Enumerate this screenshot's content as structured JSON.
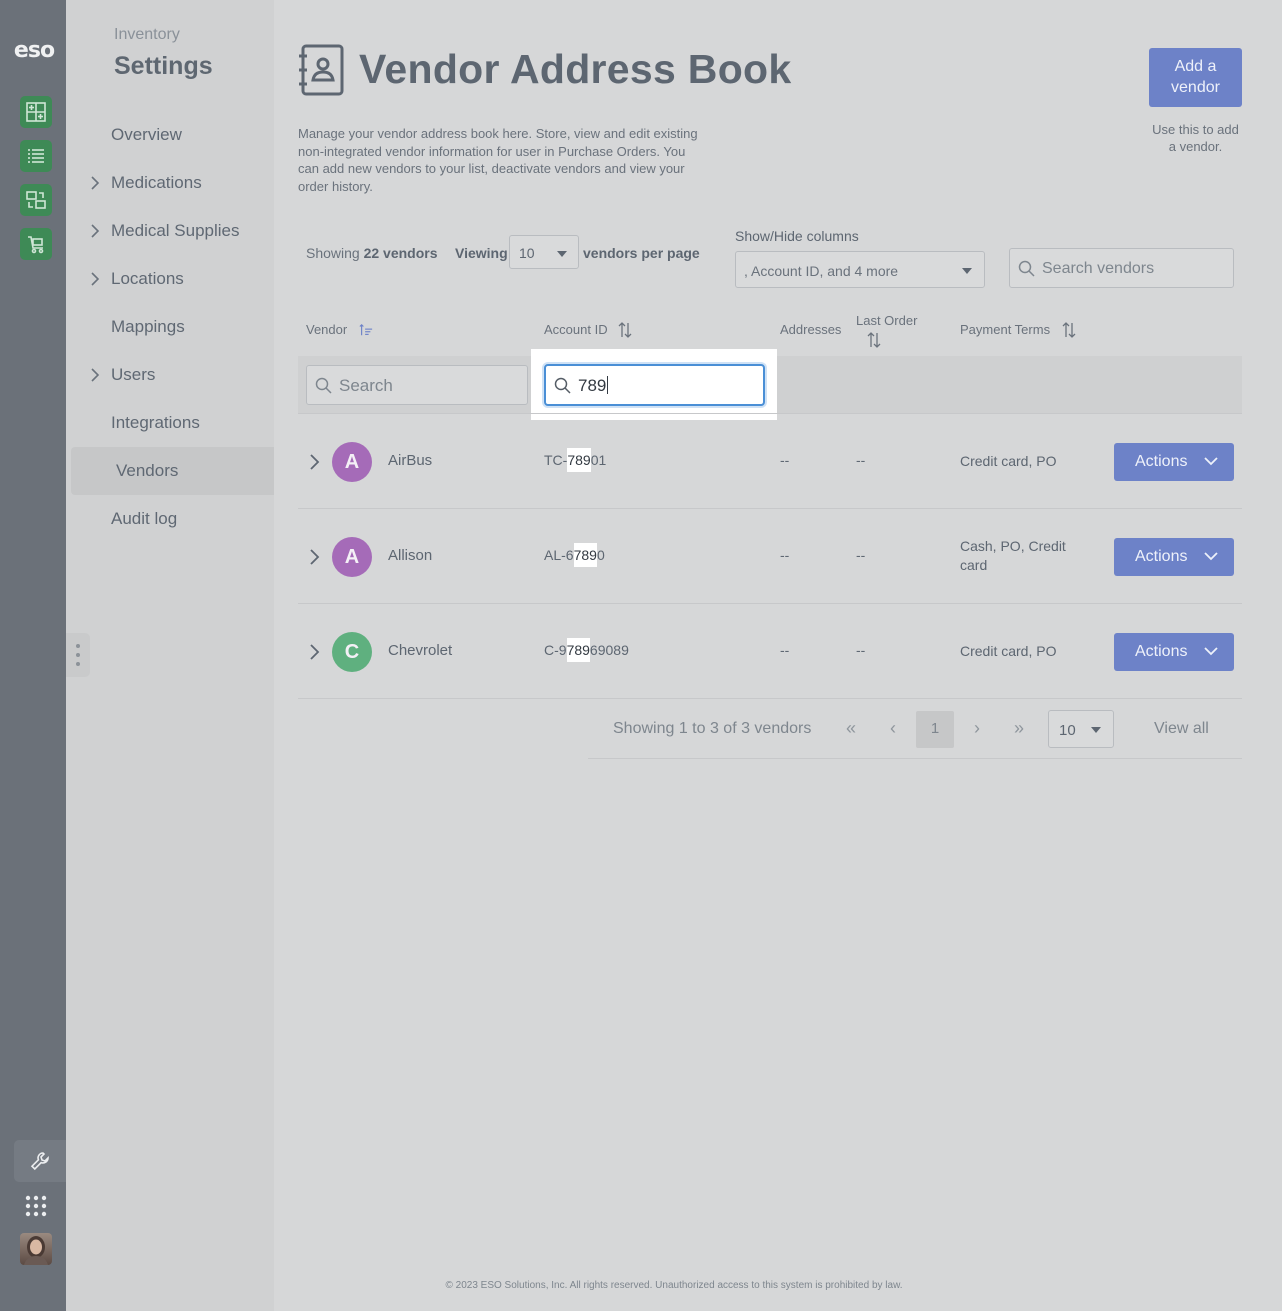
{
  "rail": {
    "logo": "eso",
    "apps": [
      {
        "icon": "inventory-grid-icon"
      },
      {
        "icon": "list-icon"
      },
      {
        "icon": "transfer-icon"
      },
      {
        "icon": "cart-icon"
      }
    ],
    "bottom": [
      "wrench-icon",
      "app-grid-icon",
      "user-avatar"
    ]
  },
  "nav": {
    "kicker": "Inventory",
    "title": "Settings",
    "items": [
      {
        "label": "Overview",
        "expandable": false
      },
      {
        "label": "Medications",
        "expandable": true
      },
      {
        "label": "Medical Supplies",
        "expandable": true
      },
      {
        "label": "Locations",
        "expandable": true
      },
      {
        "label": "Mappings",
        "expandable": false
      },
      {
        "label": "Users",
        "expandable": true
      },
      {
        "label": "Integrations",
        "expandable": false
      },
      {
        "label": "Vendors",
        "expandable": false,
        "active": true
      },
      {
        "label": "Audit log",
        "expandable": false
      }
    ]
  },
  "header": {
    "title": "Vendor Address Book",
    "description": "Manage your vendor address book here. Store, view and edit existing non-integrated vendor information for user in Purchase Orders. You can add new vendors to your list, deactivate vendors and view your order history.",
    "add_button": "Add a\nvendor",
    "add_hint": "Use this to add\na vendor."
  },
  "toolbar": {
    "showing_prefix": "Showing",
    "showing_count": "22 vendors",
    "viewing_label": "Viewing",
    "per_page": "10",
    "per_page_suffix": "vendors per page",
    "columns_label": "Show/Hide columns",
    "columns_value": ", Account ID, and 4 more",
    "search_placeholder": "Search vendors"
  },
  "table": {
    "headers": {
      "vendor": "Vendor",
      "account_id": "Account ID",
      "addresses": "Addresses",
      "last_order": "Last Order",
      "payment_terms": "Payment Terms"
    },
    "filters": {
      "vendor_placeholder": "Search",
      "account_value": "789"
    },
    "rows": [
      {
        "initial": "A",
        "avatar_color": "#a56bb8",
        "name": "AirBus",
        "acc_pre": "TC-",
        "acc_hit": "789",
        "acc_post": "01",
        "addresses": "--",
        "last_order": "--",
        "payment": "Credit card, PO",
        "action": "Actions"
      },
      {
        "initial": "A",
        "avatar_color": "#a56bb8",
        "name": "Allison",
        "acc_pre": "AL-6",
        "acc_hit": "789",
        "acc_post": "0",
        "addresses": "--",
        "last_order": "--",
        "payment": "Cash, PO, Credit card",
        "action": "Actions"
      },
      {
        "initial": "C",
        "avatar_color": "#5fb07f",
        "name": "Chevrolet",
        "acc_pre": "C-9",
        "acc_hit": "789",
        "acc_post": "69089",
        "addresses": "--",
        "last_order": "--",
        "payment": "Credit card, PO",
        "action": "Actions"
      }
    ]
  },
  "pagination": {
    "status": "Showing 1 to 3 of 3 vendors",
    "first": "«",
    "prev": "‹",
    "current": "1",
    "next": "›",
    "last": "»",
    "page_size": "10",
    "view_all": "View all"
  },
  "footer": "© 2023 ESO Solutions, Inc. All rights reserved. Unauthorized access to this system is prohibited by law.",
  "colors": {
    "accent": "#6d82c8",
    "app_green": "#3e8a56",
    "focus": "#4a8fd6"
  }
}
